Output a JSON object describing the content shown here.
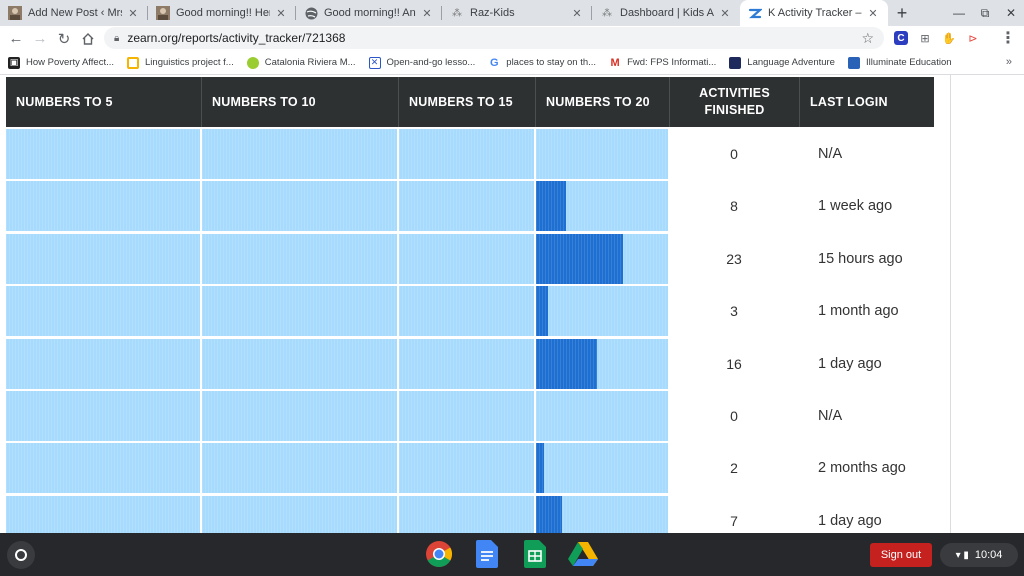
{
  "browser": {
    "tabs": [
      {
        "title": "Add New Post ‹ Mrs. Fo",
        "icon": "avatar-icon"
      },
      {
        "title": "Good morning!! Here ar",
        "icon": "avatar-icon"
      },
      {
        "title": "Good morning!! And hap",
        "icon": "globe-icon"
      },
      {
        "title": "Raz-Kids",
        "icon": "raz-kids-icon"
      },
      {
        "title": "Dashboard | Kids A-Z",
        "icon": "kids-az-icon"
      },
      {
        "title": "K Activity Tracker – Rep",
        "icon": "zearn-icon",
        "active": true
      }
    ],
    "url": "zearn.org/reports/activity_tracker/721368",
    "bookmarks": [
      {
        "label": "How Poverty Affect...",
        "icon": "bookmark-icon"
      },
      {
        "label": "Linguistics project f...",
        "icon": "slides-icon"
      },
      {
        "label": "Catalonia Riviera M...",
        "icon": "tennis-icon"
      },
      {
        "label": "Open-and-go lesso...",
        "icon": "x-icon"
      },
      {
        "label": "places to stay on th...",
        "icon": "google-icon"
      },
      {
        "label": "Fwd: FPS Informati...",
        "icon": "gmail-icon"
      },
      {
        "label": "Language Adventure",
        "icon": "site-icon"
      },
      {
        "label": "Illuminate Education",
        "icon": "illuminate-icon"
      }
    ]
  },
  "table": {
    "headers": [
      "NUMBERS TO 5",
      "NUMBERS TO 10",
      "NUMBERS TO 15",
      "NUMBERS TO 20",
      "ACTIVITIES FINISHED",
      "LAST LOGIN"
    ],
    "rows": [
      {
        "numbers_to_20_progress": 0.0,
        "activities": "0",
        "last_login": "N/A"
      },
      {
        "numbers_to_20_progress": 0.23,
        "activities": "8",
        "last_login": "1 week ago"
      },
      {
        "numbers_to_20_progress": 0.66,
        "activities": "23",
        "last_login": "15 hours ago"
      },
      {
        "numbers_to_20_progress": 0.09,
        "activities": "3",
        "last_login": "1 month ago"
      },
      {
        "numbers_to_20_progress": 0.46,
        "activities": "16",
        "last_login": "1 day ago"
      },
      {
        "numbers_to_20_progress": 0.0,
        "activities": "0",
        "last_login": "N/A"
      },
      {
        "numbers_to_20_progress": 0.06,
        "activities": "2",
        "last_login": "2 months ago"
      },
      {
        "numbers_to_20_progress": 0.2,
        "activities": "7",
        "last_login": "1 day ago"
      }
    ]
  },
  "shelf": {
    "signout_label": "Sign out",
    "time": "10:04",
    "apps": [
      "chrome-icon",
      "docs-icon",
      "sheets-icon",
      "drive-icon"
    ]
  },
  "colors": {
    "header_bg": "#2d3132",
    "bar_light": "#a7dbfd",
    "bar_fill": "#1d6fd1",
    "signout": "#c5221f"
  }
}
